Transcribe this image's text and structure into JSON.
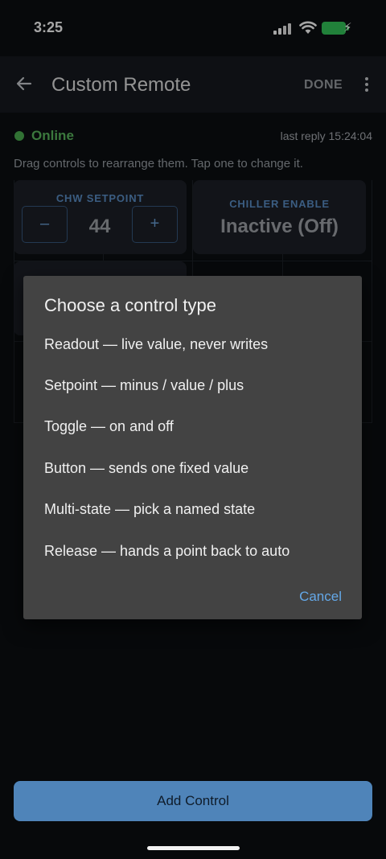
{
  "status_bar": {
    "time": "3:25"
  },
  "app_bar": {
    "title": "Custom Remote",
    "done_label": "DONE"
  },
  "connection": {
    "status": "Online",
    "last_reply": "last reply 15:24:04"
  },
  "hint": "Drag controls to rearrange them. Tap one to change it.",
  "tiles": {
    "setpoint": {
      "label": "CHW SETPOINT",
      "minus": "–",
      "value": "44",
      "plus": "+"
    },
    "chiller": {
      "label": "CHILLER ENABLE",
      "state": "Inactive (Off)"
    }
  },
  "dialog": {
    "title": "Choose a control type",
    "options": [
      "Readout — live value, never writes",
      "Setpoint — minus / value / plus",
      "Toggle — on and off",
      "Button — sends one fixed value",
      "Multi-state — pick a named state",
      "Release — hands a point back to auto"
    ],
    "cancel_label": "Cancel"
  },
  "add_control_label": "Add Control",
  "colors": {
    "accent": "#4f84b9",
    "online": "#4caf50",
    "dialog_bg": "#434343",
    "link": "#64a8e8"
  }
}
